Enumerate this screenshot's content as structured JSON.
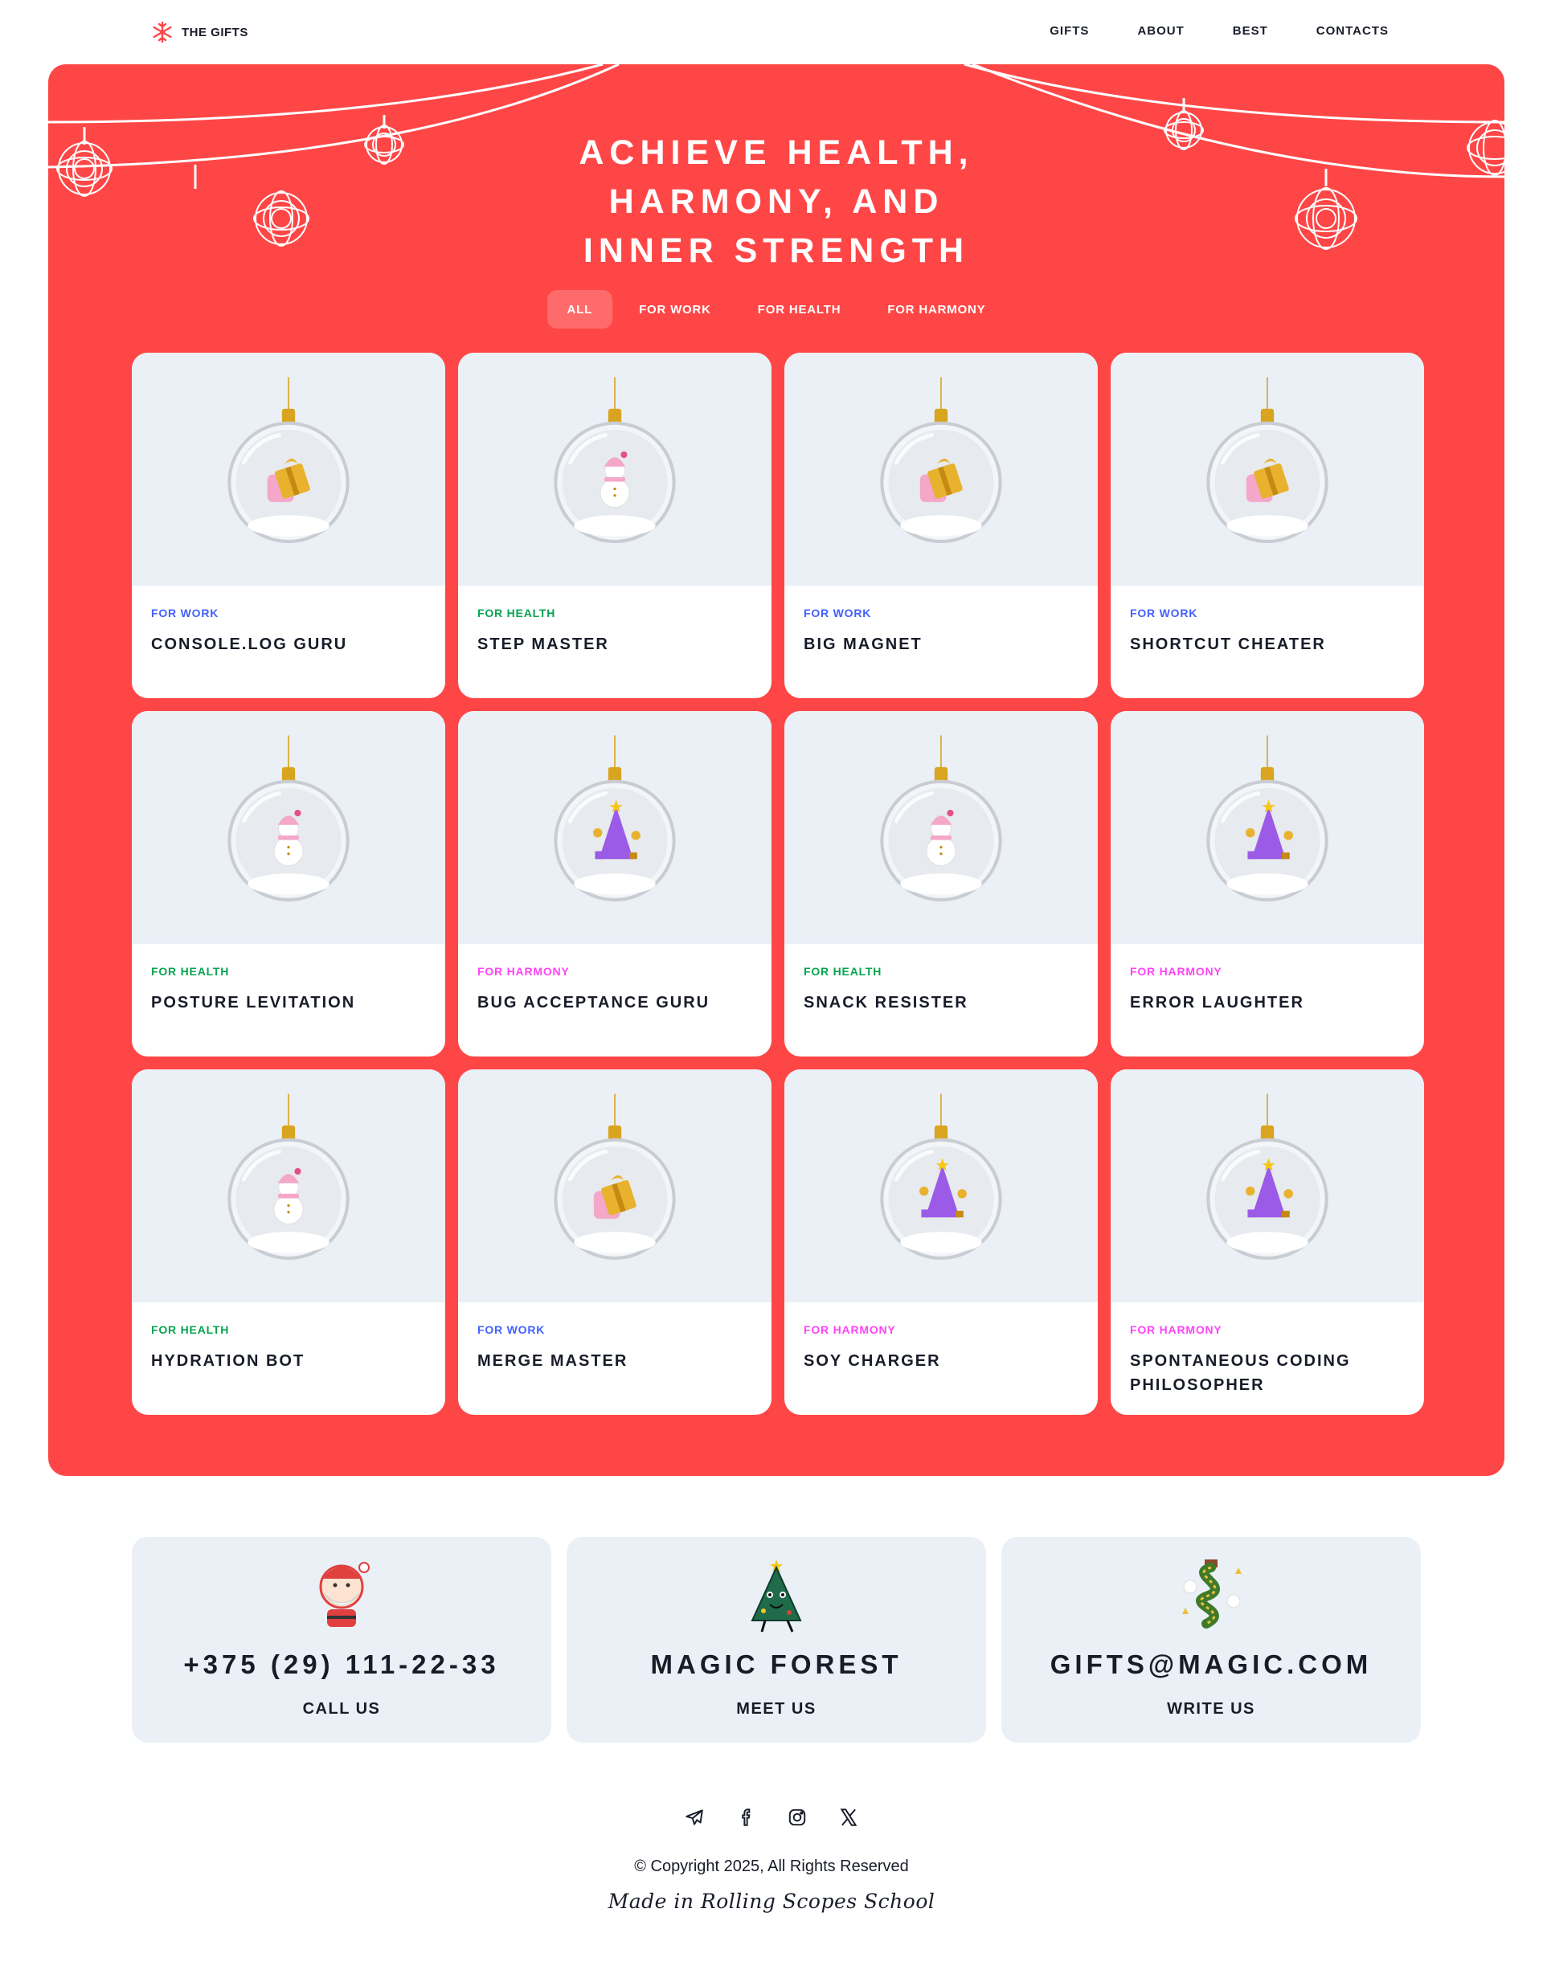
{
  "header": {
    "logo_text": "THE GIFTS",
    "nav": [
      "GIFTS",
      "ABOUT",
      "BEST",
      "CONTACTS"
    ]
  },
  "hero": {
    "title_lines": [
      "ACHIEVE HEALTH,",
      "HARMONY, AND",
      "INNER STRENGTH"
    ],
    "tabs": [
      "ALL",
      "FOR WORK",
      "FOR HEALTH",
      "FOR HARMONY"
    ],
    "active_tab": "ALL"
  },
  "gifts": [
    {
      "category": "FOR WORK",
      "name": "CONSOLE.LOG GURU",
      "icon": "gift-box-ornament"
    },
    {
      "category": "FOR HEALTH",
      "name": "STEP MASTER",
      "icon": "snowman-ornament"
    },
    {
      "category": "FOR WORK",
      "name": "BIG MAGNET",
      "icon": "gift-box-ornament"
    },
    {
      "category": "FOR WORK",
      "name": "SHORTCUT CHEATER",
      "icon": "gift-box-ornament"
    },
    {
      "category": "FOR HEALTH",
      "name": "POSTURE LEVITATION",
      "icon": "snowman-ornament"
    },
    {
      "category": "FOR HARMONY",
      "name": "BUG ACCEPTANCE GURU",
      "icon": "tree-ornament"
    },
    {
      "category": "FOR HEALTH",
      "name": "SNACK RESISTER",
      "icon": "snowman-ornament"
    },
    {
      "category": "FOR HARMONY",
      "name": "ERROR LAUGHTER",
      "icon": "tree-ornament"
    },
    {
      "category": "FOR HEALTH",
      "name": "HYDRATION BOT",
      "icon": "snowman-ornament"
    },
    {
      "category": "FOR WORK",
      "name": "MERGE MASTER",
      "icon": "gift-box-ornament"
    },
    {
      "category": "FOR HARMONY",
      "name": "SOY CHARGER",
      "icon": "tree-ornament"
    },
    {
      "category": "FOR HARMONY",
      "name": "SPONTANEOUS CODING PHILOSOPHER",
      "icon": "tree-ornament"
    }
  ],
  "contacts": [
    {
      "value": "+375 (29) 111-22-33",
      "label": "CALL US",
      "icon": "santa-illustration"
    },
    {
      "value": "MAGIC FOREST",
      "label": "MEET US",
      "icon": "christmas-tree-illustration"
    },
    {
      "value": "GIFTS@MAGIC.COM",
      "label": "WRITE US",
      "icon": "dragon-illustration"
    }
  ],
  "footer": {
    "socials": [
      "telegram-icon",
      "facebook-icon",
      "instagram-icon",
      "x-icon"
    ],
    "copyright": "© Copyright 2025, All Rights Reserved",
    "made_by": "Made in Rolling Scopes School"
  },
  "colors": {
    "accent": "#FF4646",
    "card_bg": "#EAF0F6",
    "work": "#4361FF",
    "health": "#06A44F",
    "harmony": "#FF43F7",
    "text": "#181C29"
  }
}
